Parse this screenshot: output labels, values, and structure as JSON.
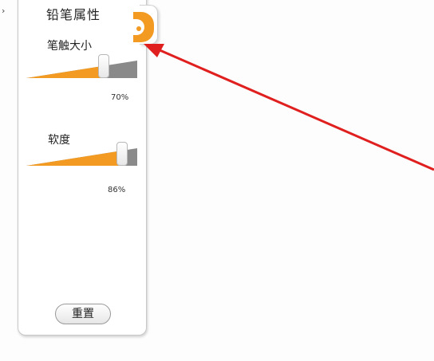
{
  "panel": {
    "title": "铅笔属性",
    "edge_glyph": "›"
  },
  "brush_size": {
    "label": "笔触大小",
    "value_text": "70%",
    "value": 0.7
  },
  "softness": {
    "label": "软度",
    "value_text": "86%",
    "value": 0.86
  },
  "reset_button": {
    "label": "重置"
  },
  "colors": {
    "accent": "#f29a22",
    "track_empty": "#8a8a8a",
    "annotation_arrow": "#e01f1f"
  },
  "icons": {
    "panel_tab": "pencil-properties-tab-icon",
    "annotation": "red-arrow-annotation"
  }
}
